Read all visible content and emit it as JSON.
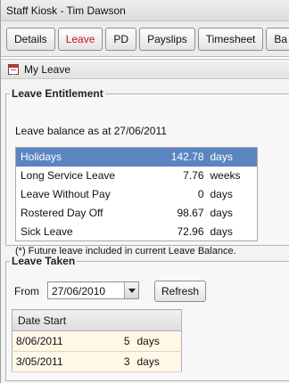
{
  "window": {
    "title": "Staff Kiosk - Tim Dawson"
  },
  "tabs": [
    {
      "label": "Details",
      "active": false
    },
    {
      "label": "Leave",
      "active": true
    },
    {
      "label": "PD",
      "active": false
    },
    {
      "label": "Payslips",
      "active": false
    },
    {
      "label": "Timesheet",
      "active": false
    },
    {
      "label": "Ba",
      "active": false
    }
  ],
  "section": {
    "title": "My Leave",
    "icon": "calendar-icon"
  },
  "entitlement": {
    "legend": "Leave Entitlement",
    "as_at": "Leave balance as at 27/06/2011",
    "rows": [
      {
        "type": "Holidays",
        "value": "142.78",
        "unit": "days",
        "selected": true
      },
      {
        "type": "Long Service Leave",
        "value": "7.76",
        "unit": "weeks"
      },
      {
        "type": "Leave Without Pay",
        "value": "0",
        "unit": "days"
      },
      {
        "type": "Rostered Day Off",
        "value": "98.67",
        "unit": "days"
      },
      {
        "type": "Sick Leave",
        "value": "72.96",
        "unit": "days"
      }
    ],
    "footnote": "(*) Future leave included in current Leave Balance."
  },
  "taken": {
    "legend": "Leave Taken",
    "from_label": "From",
    "from_value": "27/06/2010",
    "refresh_label": "Refresh",
    "columns": [
      "Date Start"
    ],
    "rows": [
      {
        "date": "8/06/2011",
        "amount": "5",
        "unit": "days"
      },
      {
        "date": "3/05/2011",
        "amount": "3",
        "unit": "days"
      }
    ]
  },
  "colors": {
    "selected_row": "#5b85c0",
    "active_tab": "#c8102e"
  }
}
